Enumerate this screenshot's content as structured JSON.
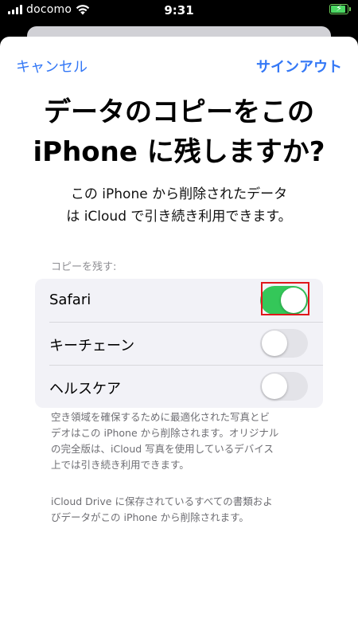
{
  "status_bar": {
    "carrier": "docomo",
    "time": "9:31",
    "battery_color": "#4cd964"
  },
  "nav": {
    "cancel_label": "キャンセル",
    "sign_out_label": "サインアウト"
  },
  "title_lines": [
    "データのコピーをこの",
    "iPhone に残しますか?"
  ],
  "subtitle_lines": [
    "この iPhone から削除されたデータ",
    "は iCloud で引き続き利用できます。"
  ],
  "section_header": "コピーを残す:",
  "toggles": [
    {
      "label": "Safari",
      "on": true,
      "highlighted": true
    },
    {
      "label": "キーチェーン",
      "on": false
    },
    {
      "label": "ヘルスケア",
      "on": false
    }
  ],
  "footnote_1_lines": [
    "空き領域を確保するために最適化された写真とビ",
    "デオはこの iPhone から削除されます。オリジナル",
    "の完全版は、iCloud 写真を使用しているデバイス",
    "上では引き続き利用できます。"
  ],
  "footnote_2_lines": [
    "iCloud Drive に保存されているすべての書類およ",
    "びデータがこの iPhone から削除されます。"
  ],
  "colors": {
    "accent": "#3478f6",
    "toggle_on": "#34c759",
    "highlight_box": "#e0161b"
  },
  "icons": [
    "cellular-signal-icon",
    "wifi-icon",
    "battery-charging-icon"
  ]
}
